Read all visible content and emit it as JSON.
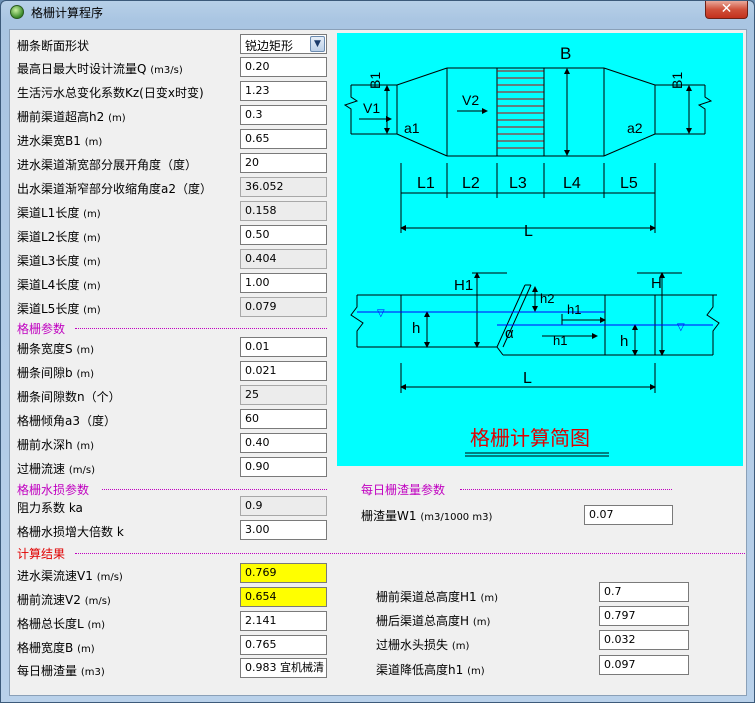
{
  "window": {
    "title": "格栅计算程序",
    "close_label": "✕"
  },
  "inputs": [
    {
      "key": "shape",
      "label": "栅条断面形状",
      "unit": "",
      "value": "锐边矩形",
      "type": "combo"
    },
    {
      "key": "Q",
      "label": "最高日最大时设计流量Q",
      "unit": "(m3/s)",
      "value": "0.20",
      "type": "input"
    },
    {
      "key": "Kz",
      "label": "生活污水总变化系数Kz(日变x时变)",
      "unit": "",
      "value": "1.23",
      "type": "input"
    },
    {
      "key": "h2",
      "label": "栅前渠道超高h2",
      "unit": "(m)",
      "value": "0.3",
      "type": "input"
    },
    {
      "key": "B1",
      "label": "进水渠宽B1",
      "unit": "(m)",
      "value": "0.65",
      "type": "input"
    },
    {
      "key": "a1",
      "label": "进水渠道渐宽部分展开角度（度）",
      "unit": "",
      "value": "20",
      "type": "input"
    },
    {
      "key": "a2",
      "label": "出水渠道渐窄部分收缩角度a2（度）",
      "unit": "",
      "value": "36.052",
      "type": "ro"
    },
    {
      "key": "L1",
      "label": "渠道L1长度",
      "unit": "(m)",
      "value": "0.158",
      "type": "ro"
    },
    {
      "key": "L2",
      "label": "渠道L2长度",
      "unit": "(m)",
      "value": "0.50",
      "type": "input"
    },
    {
      "key": "L3",
      "label": "渠道L3长度",
      "unit": "(m)",
      "value": "0.404",
      "type": "ro"
    },
    {
      "key": "L4",
      "label": "渠道L4长度",
      "unit": "(m)",
      "value": "1.00",
      "type": "input"
    },
    {
      "key": "L5",
      "label": "渠道L5长度",
      "unit": "(m)",
      "value": "0.079",
      "type": "ro"
    }
  ],
  "grid_section": {
    "title": "格栅参数"
  },
  "grid_params": [
    {
      "key": "S",
      "label": "栅条宽度S",
      "unit": "(m)",
      "value": "0.01",
      "type": "input"
    },
    {
      "key": "b",
      "label": "栅条间隙b",
      "unit": "(m)",
      "value": "0.021",
      "type": "input"
    },
    {
      "key": "n",
      "label": "栅条间隙数n（个）",
      "unit": "",
      "value": "25",
      "type": "ro"
    },
    {
      "key": "a3",
      "label": "格栅倾角a3（度）",
      "unit": "",
      "value": "60",
      "type": "input"
    },
    {
      "key": "h",
      "label": "栅前水深h",
      "unit": "(m)",
      "value": "0.40",
      "type": "input"
    },
    {
      "key": "v",
      "label": "过栅流速",
      "unit": "(m/s)",
      "value": "0.90",
      "type": "input"
    }
  ],
  "loss_section": {
    "title": "格栅水损参数"
  },
  "loss_params": [
    {
      "key": "ka",
      "label": "阻力系数 ka",
      "unit": "",
      "value": "0.9",
      "type": "ro"
    },
    {
      "key": "k",
      "label": "格栅水损增大倍数 k",
      "unit": "",
      "value": "3.00",
      "type": "input"
    }
  ],
  "screenings_section": {
    "title": "每日栅渣量参数"
  },
  "screenings_param": {
    "label": "栅渣量W1",
    "unit": "(m3/1000 m3)",
    "value": "0.07"
  },
  "result_section": {
    "title": "计算结果"
  },
  "results_left": [
    {
      "key": "V1",
      "label": "进水渠流速V1",
      "unit": "(m/s)",
      "value": "0.769",
      "type": "hl"
    },
    {
      "key": "V2",
      "label": "栅前流速V2",
      "unit": "(m/s)",
      "value": "0.654",
      "type": "hl"
    },
    {
      "key": "L",
      "label": "格栅总长度L",
      "unit": "(m)",
      "value": "2.141",
      "type": "input"
    },
    {
      "key": "B",
      "label": "格栅宽度B",
      "unit": "(m)",
      "value": "0.765",
      "type": "input"
    },
    {
      "key": "W",
      "label": "每日栅渣量",
      "unit": "(m3)",
      "value": "0.983 宜机械清",
      "type": "input"
    }
  ],
  "results_right": [
    {
      "key": "H1",
      "label": "栅前渠道总高度H1",
      "unit": "(m)",
      "value": "0.7"
    },
    {
      "key": "H",
      "label": "栅后渠道总高度H",
      "unit": "(m)",
      "value": "0.797"
    },
    {
      "key": "h1",
      "label": "过栅水头损失",
      "unit": "(m)",
      "value": "0.032"
    },
    {
      "key": "hd",
      "label": "渠道降低高度h1",
      "unit": "(m)",
      "value": "0.097"
    }
  ],
  "diagram": {
    "title": "格栅计算简图",
    "labels": {
      "B": "B",
      "B1": "B1",
      "V1": "V1",
      "V2": "V2",
      "a1": "a1",
      "a2": "a2",
      "L1": "L1",
      "L2": "L2",
      "L3": "L3",
      "L4": "L4",
      "L5": "L5",
      "L": "L",
      "H1": "H1",
      "H": "H",
      "h": "h",
      "h2": "h2",
      "h1": "h1",
      "alpha": "α"
    }
  },
  "colors": {
    "diagram_bg": "#00ffff",
    "highlight": "#ffff00",
    "section_magenta": "#c000c0",
    "section_red": "#e00000",
    "diagram_title": "#e00000"
  }
}
